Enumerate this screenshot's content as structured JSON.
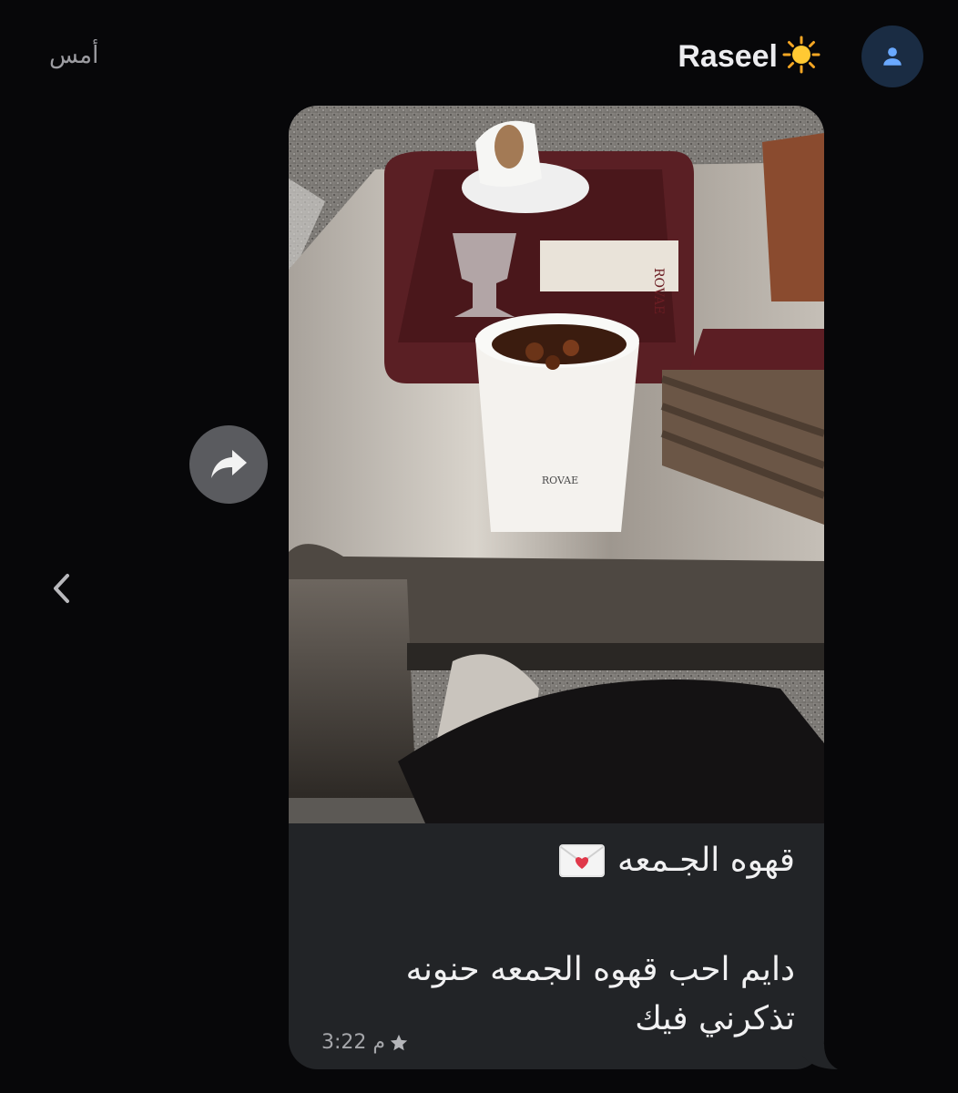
{
  "header": {
    "date_label": "أمس",
    "contact_name": "Raseel",
    "contact_emoji": "sun-emoji",
    "avatar_icon": "person-icon",
    "avatar_color": "#1a2c43",
    "avatar_icon_color": "#6aa9ff"
  },
  "message": {
    "image": "photo of iced coffee on a metal table with tray",
    "cup_brand": "ROVAE",
    "caption_title": "قهوه الجـمعه",
    "caption_title_icon": "love-letter-icon",
    "caption_line1": "دايم احب قهوه الجمعه حنونه",
    "caption_line2": "تذكرني فيك",
    "time": "3:22 م",
    "starred_icon": "star-icon",
    "bubble_color": "#222427"
  },
  "actions": {
    "forward_icon": "share-forward-icon",
    "back_icon": "chevron-left-icon"
  }
}
